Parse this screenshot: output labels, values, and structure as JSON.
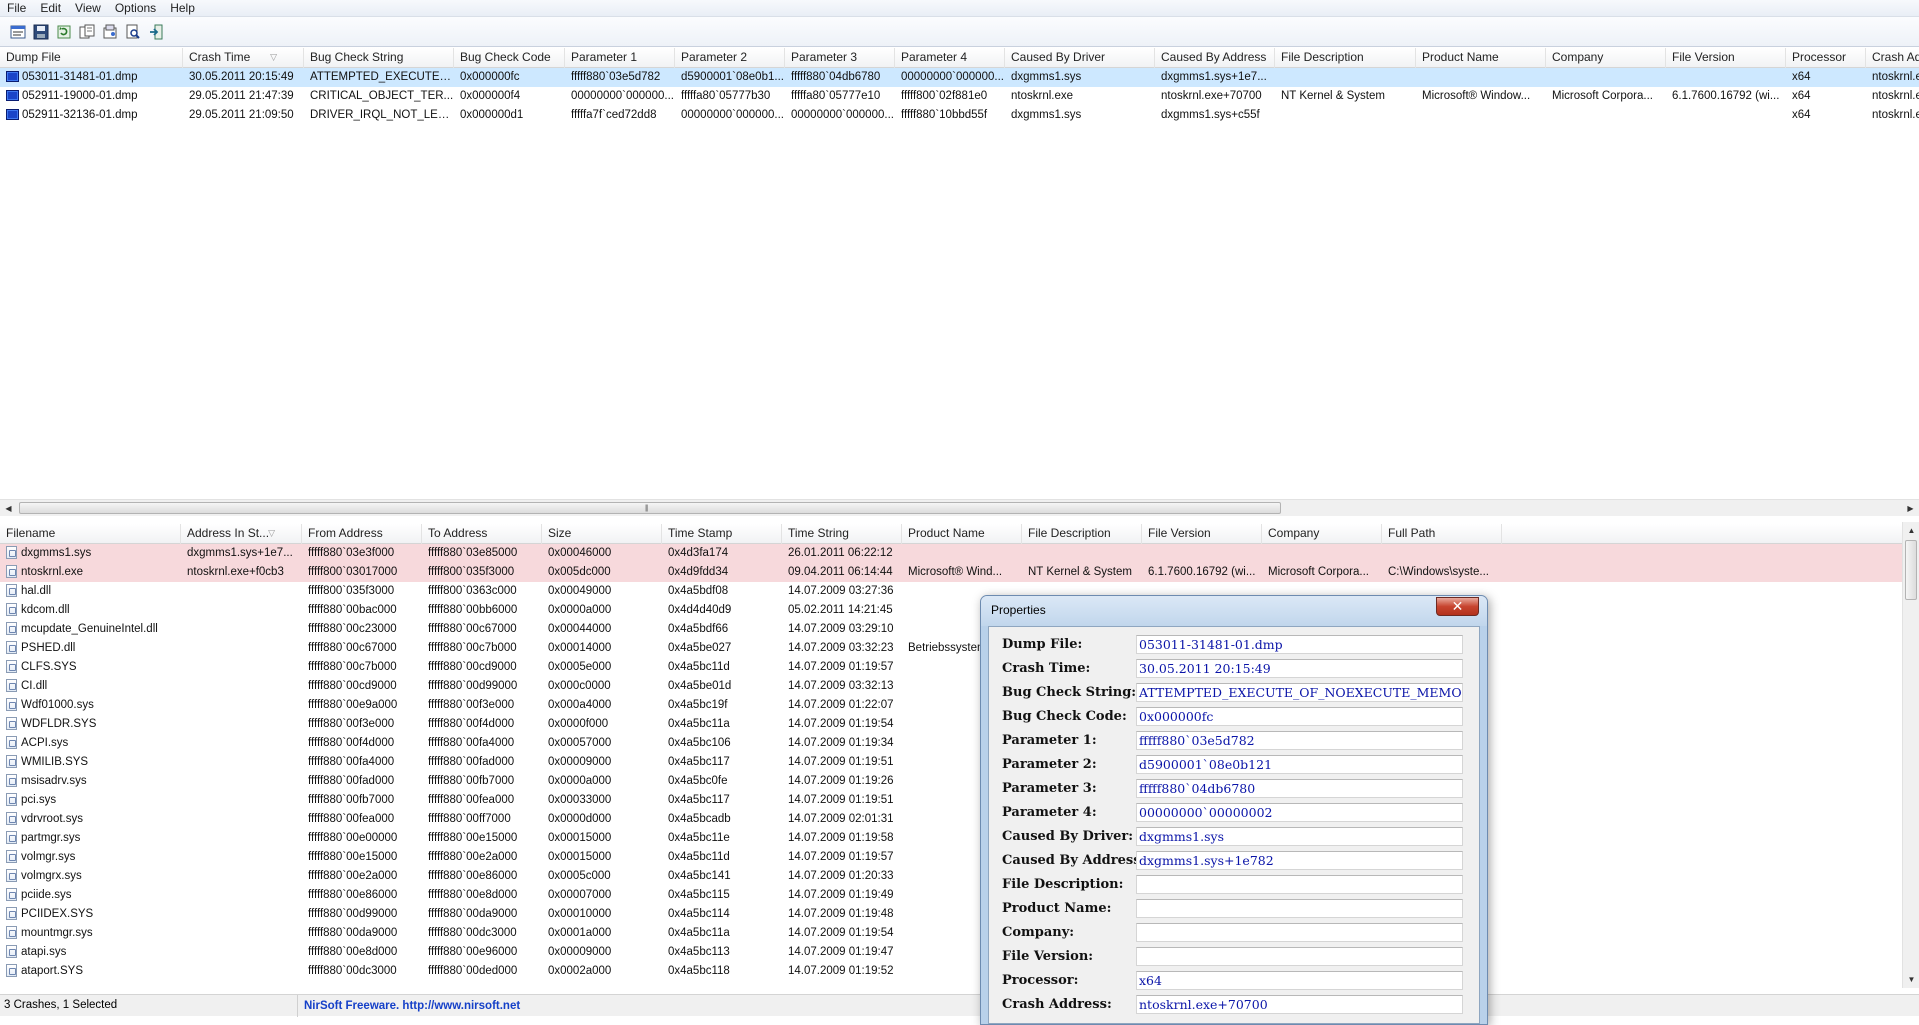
{
  "menu": {
    "file": "File",
    "edit": "Edit",
    "view": "View",
    "options": "Options",
    "help": "Help"
  },
  "toolbar": {
    "icons": [
      "properties-icon",
      "save-icon",
      "refresh-icon",
      "copy-icon",
      "html-report-icon",
      "find-icon",
      "exit-icon"
    ]
  },
  "crash_list": {
    "columns": [
      "Dump File",
      "Crash Time",
      "Bug Check String",
      "Bug Check Code",
      "Parameter 1",
      "Parameter 2",
      "Parameter 3",
      "Parameter 4",
      "Caused By Driver",
      "Caused By Address",
      "File Description",
      "Product Name",
      "Company",
      "File Version",
      "Processor",
      "Crash Add"
    ],
    "rows": [
      [
        "053011-31481-01.dmp",
        "30.05.2011 20:15:49",
        "ATTEMPTED_EXECUTE_...",
        "0x000000fc",
        "fffff880`03e5d782",
        "d5900001`08e0b1...",
        "fffff880`04db6780",
        "00000000`000000...",
        "dxgmms1.sys",
        "dxgmms1.sys+1e7...",
        "",
        "",
        "",
        "",
        "x64",
        "ntoskrnl.e"
      ],
      [
        "052911-19000-01.dmp",
        "29.05.2011 21:47:39",
        "CRITICAL_OBJECT_TER...",
        "0x000000f4",
        "00000000`000000...",
        "fffffa80`05777b30",
        "fffffa80`05777e10",
        "fffff800`02f881e0",
        "ntoskrnl.exe",
        "ntoskrnl.exe+70700",
        "NT Kernel & System",
        "Microsoft® Window...",
        "Microsoft Corpora...",
        "6.1.7600.16792 (wi...",
        "x64",
        "ntoskrnl.e"
      ],
      [
        "052911-32136-01.dmp",
        "29.05.2011 21:09:50",
        "DRIVER_IRQL_NOT_LESS...",
        "0x000000d1",
        "fffffa7f`ced72dd8",
        "00000000`000000...",
        "00000000`000000...",
        "fffff880`10bbd55f",
        "dxgmms1.sys",
        "dxgmms1.sys+c55f",
        "",
        "",
        "",
        "",
        "x64",
        "ntoskrnl.e"
      ]
    ]
  },
  "module_list": {
    "columns": [
      "Filename",
      "Address In St...",
      "From Address",
      "To Address",
      "Size",
      "Time Stamp",
      "Time String",
      "Product Name",
      "File Description",
      "File Version",
      "Company",
      "Full Path"
    ],
    "rows": [
      [
        "dxgmms1.sys",
        "dxgmms1.sys+1e7...",
        "fffff880`03e3f000",
        "fffff880`03e85000",
        "0x00046000",
        "0x4d3fa174",
        "26.01.2011 06:22:12",
        "",
        "",
        "",
        "",
        ""
      ],
      [
        "ntoskrnl.exe",
        "ntoskrnl.exe+f0cb3",
        "fffff800`03017000",
        "fffff800`035f3000",
        "0x005dc000",
        "0x4d9fdd34",
        "09.04.2011 06:14:44",
        "Microsoft® Wind...",
        "NT Kernel & System",
        "6.1.7600.16792 (wi...",
        "Microsoft Corpora...",
        "C:\\Windows\\syste..."
      ],
      [
        "hal.dll",
        "",
        "fffff800`035f3000",
        "fffff800`0363c000",
        "0x00049000",
        "0x4a5bdf08",
        "14.07.2009 03:27:36",
        "",
        "",
        "",
        "",
        ""
      ],
      [
        "kdcom.dll",
        "",
        "fffff880`00bac000",
        "fffff880`00bb6000",
        "0x0000a000",
        "0x4d4d40d9",
        "05.02.2011 14:21:45",
        "",
        "",
        "",
        "",
        ""
      ],
      [
        "mcupdate_GenuineIntel.dll",
        "",
        "fffff880`00c23000",
        "fffff880`00c67000",
        "0x00044000",
        "0x4a5bdf66",
        "14.07.2009 03:29:10",
        "",
        "",
        "",
        "",
        ""
      ],
      [
        "PSHED.dll",
        "",
        "fffff880`00c67000",
        "fffff880`00c7b000",
        "0x00014000",
        "0x4a5be027",
        "14.07.2009 03:32:23",
        "Betriebssystem",
        "",
        "",
        "",
        ""
      ],
      [
        "CLFS.SYS",
        "",
        "fffff880`00c7b000",
        "fffff880`00cd9000",
        "0x0005e000",
        "0x4a5bc11d",
        "14.07.2009 01:19:57",
        "",
        "",
        "",
        "",
        ""
      ],
      [
        "CI.dll",
        "",
        "fffff880`00cd9000",
        "fffff880`00d99000",
        "0x000c0000",
        "0x4a5be01d",
        "14.07.2009 03:32:13",
        "",
        "",
        "",
        "",
        ""
      ],
      [
        "Wdf01000.sys",
        "",
        "fffff880`00e9a000",
        "fffff880`00f3e000",
        "0x000a4000",
        "0x4a5bc19f",
        "14.07.2009 01:22:07",
        "",
        "",
        "",
        "",
        ""
      ],
      [
        "WDFLDR.SYS",
        "",
        "fffff880`00f3e000",
        "fffff880`00f4d000",
        "0x0000f000",
        "0x4a5bc11a",
        "14.07.2009 01:19:54",
        "",
        "",
        "",
        "",
        ""
      ],
      [
        "ACPI.sys",
        "",
        "fffff880`00f4d000",
        "fffff880`00fa4000",
        "0x00057000",
        "0x4a5bc106",
        "14.07.2009 01:19:34",
        "",
        "",
        "",
        "",
        ""
      ],
      [
        "WMILIB.SYS",
        "",
        "fffff880`00fa4000",
        "fffff880`00fad000",
        "0x00009000",
        "0x4a5bc117",
        "14.07.2009 01:19:51",
        "",
        "",
        "",
        "",
        ""
      ],
      [
        "msisadrv.sys",
        "",
        "fffff880`00fad000",
        "fffff880`00fb7000",
        "0x0000a000",
        "0x4a5bc0fe",
        "14.07.2009 01:19:26",
        "",
        "",
        "",
        "",
        ""
      ],
      [
        "pci.sys",
        "",
        "fffff880`00fb7000",
        "fffff880`00fea000",
        "0x00033000",
        "0x4a5bc117",
        "14.07.2009 01:19:51",
        "",
        "",
        "",
        "",
        ""
      ],
      [
        "vdrvroot.sys",
        "",
        "fffff880`00fea000",
        "fffff880`00ff7000",
        "0x0000d000",
        "0x4a5bcadb",
        "14.07.2009 02:01:31",
        "",
        "",
        "",
        "",
        ""
      ],
      [
        "partmgr.sys",
        "",
        "fffff880`00e00000",
        "fffff880`00e15000",
        "0x00015000",
        "0x4a5bc11e",
        "14.07.2009 01:19:58",
        "",
        "",
        "",
        "",
        ""
      ],
      [
        "volmgr.sys",
        "",
        "fffff880`00e15000",
        "fffff880`00e2a000",
        "0x00015000",
        "0x4a5bc11d",
        "14.07.2009 01:19:57",
        "",
        "",
        "",
        "",
        ""
      ],
      [
        "volmgrx.sys",
        "",
        "fffff880`00e2a000",
        "fffff880`00e86000",
        "0x0005c000",
        "0x4a5bc141",
        "14.07.2009 01:20:33",
        "",
        "",
        "",
        "",
        ""
      ],
      [
        "pciide.sys",
        "",
        "fffff880`00e86000",
        "fffff880`00e8d000",
        "0x00007000",
        "0x4a5bc115",
        "14.07.2009 01:19:49",
        "",
        "",
        "",
        "",
        ""
      ],
      [
        "PCIIDEX.SYS",
        "",
        "fffff880`00d99000",
        "fffff880`00da9000",
        "0x00010000",
        "0x4a5bc114",
        "14.07.2009 01:19:48",
        "",
        "",
        "",
        "",
        ""
      ],
      [
        "mountmgr.sys",
        "",
        "fffff880`00da9000",
        "fffff880`00dc3000",
        "0x0001a000",
        "0x4a5bc11a",
        "14.07.2009 01:19:54",
        "",
        "",
        "",
        "",
        ""
      ],
      [
        "atapi.sys",
        "",
        "fffff880`00e8d000",
        "fffff880`00e96000",
        "0x00009000",
        "0x4a5bc113",
        "14.07.2009 01:19:47",
        "",
        "",
        "",
        "",
        ""
      ],
      [
        "ataport.SYS",
        "",
        "fffff880`00dc3000",
        "fffff880`00ded000",
        "0x0002a000",
        "0x4a5bc118",
        "14.07.2009 01:19:52",
        "",
        "",
        "",
        "",
        ""
      ]
    ]
  },
  "statusbar": {
    "count": "3 Crashes, 1 Selected",
    "link": "NirSoft Freeware.  http://www.nirsoft.net"
  },
  "properties": {
    "title": "Properties",
    "close": "✕",
    "fields": [
      {
        "label": "Dump File:",
        "value": "053011-31481-01.dmp"
      },
      {
        "label": "Crash Time:",
        "value": "30.05.2011 20:15:49"
      },
      {
        "label": "Bug Check String:",
        "value": "ATTEMPTED_EXECUTE_OF_NOEXECUTE_MEMO"
      },
      {
        "label": "Bug Check Code:",
        "value": "0x000000fc"
      },
      {
        "label": "Parameter 1:",
        "value": "fffff880`03e5d782"
      },
      {
        "label": "Parameter 2:",
        "value": "d5900001`08e0b121"
      },
      {
        "label": "Parameter 3:",
        "value": "fffff880`04db6780"
      },
      {
        "label": "Parameter 4:",
        "value": "00000000`00000002"
      },
      {
        "label": "Caused By Driver:",
        "value": "dxgmms1.sys"
      },
      {
        "label": "Caused By Address:",
        "value": "dxgmms1.sys+1e782"
      },
      {
        "label": "File Description:",
        "value": ""
      },
      {
        "label": "Product Name:",
        "value": ""
      },
      {
        "label": "Company:",
        "value": ""
      },
      {
        "label": "File Version:",
        "value": ""
      },
      {
        "label": "Processor:",
        "value": "x64"
      },
      {
        "label": "Crash Address:",
        "value": "ntoskrnl.exe+70700"
      }
    ]
  }
}
